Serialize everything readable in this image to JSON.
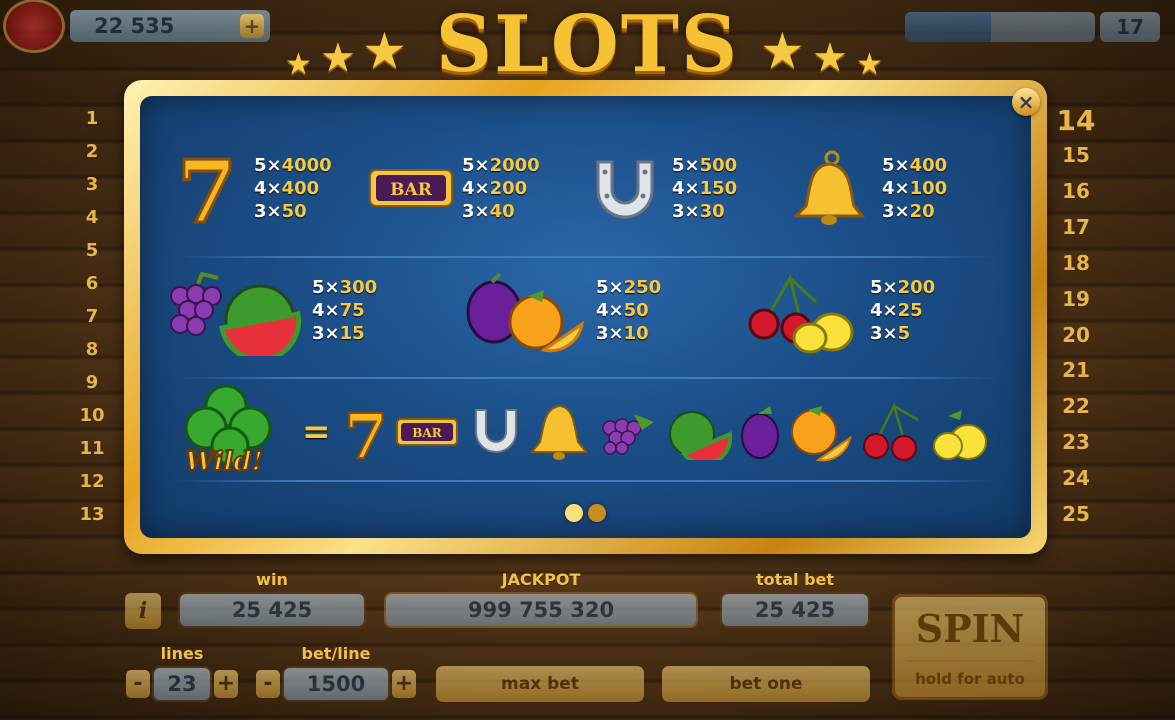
{
  "title": "SLOTS",
  "balance": {
    "value": "22 535",
    "plus": "+"
  },
  "level": {
    "value": "17",
    "progress": 0.45
  },
  "close_label": "×",
  "line_numbers_left": [
    "1",
    "2",
    "3",
    "4",
    "5",
    "6",
    "7",
    "8",
    "9",
    "10",
    "11",
    "12",
    "13"
  ],
  "line_numbers_right": [
    "14",
    "15",
    "16",
    "17",
    "18",
    "19",
    "20",
    "21",
    "22",
    "23",
    "24",
    "25"
  ],
  "paytable": {
    "seven": {
      "p5": "4000",
      "p4": "400",
      "p3": "50"
    },
    "bar": {
      "label": "BAR",
      "p5": "2000",
      "p4": "200",
      "p3": "40"
    },
    "horseshoe": {
      "p5": "500",
      "p4": "150",
      "p3": "30"
    },
    "bell": {
      "p5": "400",
      "p4": "100",
      "p3": "20"
    },
    "grapes_melon": {
      "p5": "300",
      "p4": "75",
      "p3": "15"
    },
    "plum_orange": {
      "p5": "250",
      "p4": "50",
      "p3": "10"
    },
    "cherry_lemon": {
      "p5": "200",
      "p4": "25",
      "p3": "5"
    },
    "x5": "5×",
    "x4": "4×",
    "x3": "3×",
    "wild_label": "Wild!",
    "equals": "="
  },
  "controls": {
    "win_label": "win",
    "win_value": "25 425",
    "jackpot_label": "JACKPOT",
    "jackpot_value": "999 755 320",
    "total_bet_label": "total bet",
    "total_bet_value": "25 425",
    "lines_label": "lines",
    "lines_value": "23",
    "bet_line_label": "bet/line",
    "bet_line_value": "1500",
    "minus": "-",
    "plus": "+",
    "max_bet": "max bet",
    "bet_one": "bet one",
    "spin": "SPIN",
    "spin_sub": "hold for auto",
    "info": "i"
  },
  "colors": {
    "gold": "#f7c842",
    "panel": "#1b4e87",
    "wood": "#4a2e14"
  }
}
